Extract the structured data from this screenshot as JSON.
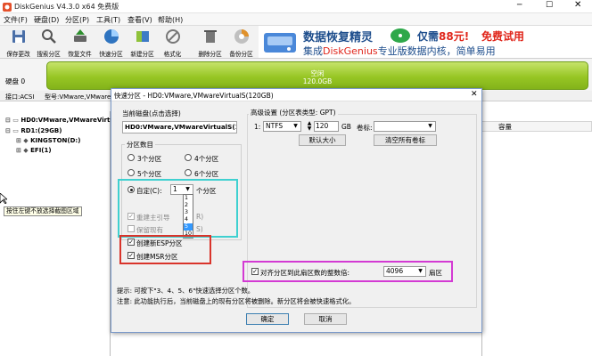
{
  "window": {
    "title": "DiskGenius V4.3.0 x64 免费版"
  },
  "menu": [
    "文件(F)",
    "硬盘(D)",
    "分区(P)",
    "工具(T)",
    "查看(V)",
    "帮助(H)"
  ],
  "toolbar": [
    {
      "label": "保存更改",
      "icon": "save-icon"
    },
    {
      "label": "搜索分区",
      "icon": "search-icon"
    },
    {
      "label": "恢复文件",
      "icon": "recover-icon"
    },
    {
      "label": "快速分区",
      "icon": "quick-partition-icon"
    },
    {
      "label": "新建分区",
      "icon": "new-partition-icon"
    },
    {
      "label": "格式化",
      "icon": "format-icon"
    },
    {
      "label": "删除分区",
      "icon": "delete-icon"
    },
    {
      "label": "备份分区",
      "icon": "backup-icon"
    }
  ],
  "ad": {
    "line1_a": "数据恢复精灵",
    "line1_b": "仅需",
    "line1_price": "88元!",
    "line1_c": "免费试用",
    "line2_a": "集成",
    "line2_b": "DiskGenius",
    "line2_c": "专业版数据内核，简单易用"
  },
  "disk": {
    "label": "硬盘 0",
    "free_label": "空闲",
    "free_size": "120.0GB"
  },
  "infobar": {
    "interface": "接口:ACSI",
    "model": "型号:VMware,VMwareVirtualS"
  },
  "tree": {
    "items": [
      "HD0:VMware,VMwareVirtualS",
      "RD1:(29GB)",
      "KINGSTON(D:)",
      "EFI(1)"
    ],
    "tooltip": "按住左键不放选择截图区域"
  },
  "right_header": {
    "capacity": "容量"
  },
  "dialog": {
    "title": "快速分区 - HD0:VMware,VMwareVirtualS(120GB)",
    "current_disk_label": "当前磁盘(点击选择)",
    "current_disk_value": "HD0:VMware,VMwareVirtualS(1",
    "count_group_label": "分区数目",
    "options": [
      "3个分区",
      "4个分区",
      "5个分区",
      "6个分区"
    ],
    "custom_label": "自定(C):",
    "custom_value": "1",
    "custom_suffix": "个分区",
    "dropdown_items": [
      "1",
      "2",
      "3",
      "4",
      "5",
      "10"
    ],
    "rebuild_mbr": "重建主引导",
    "rebuild_suffix": "R)",
    "keep_existing": "保留现有",
    "keep_suffix": "S)",
    "create_esp": "创建新ESP分区",
    "create_msr": "创建MSR分区",
    "advanced_label": "高级设置 (分区表类型: GPT)",
    "row_num": "1:",
    "fs_value": "NTFS",
    "size_value": "120",
    "size_unit": "GB",
    "volume_label": "卷标:",
    "default_size_btn": "默认大小",
    "clear_labels_btn": "清空所有卷标",
    "align_label": "对齐分区到此扇区数的整数倍:",
    "align_value": "4096",
    "align_unit": "扇区",
    "hint": "提示: 可按下\"3、4、5、6\"快速选择分区个数。",
    "warning": "注意: 此功能执行后，当前磁盘上的现有分区将被删除。新分区将会被快速格式化。",
    "ok_btn": "确定",
    "cancel_btn": "取消"
  },
  "colors": {
    "disk_green": "#97c624",
    "ad_red": "#e0261b",
    "ad_blue": "#1d4d8c",
    "cyan_highlight": "#3fd0d0",
    "red_highlight": "#d9342b",
    "magenta_highlight": "#d33ad3",
    "dropdown_selected": "#3399ff"
  }
}
